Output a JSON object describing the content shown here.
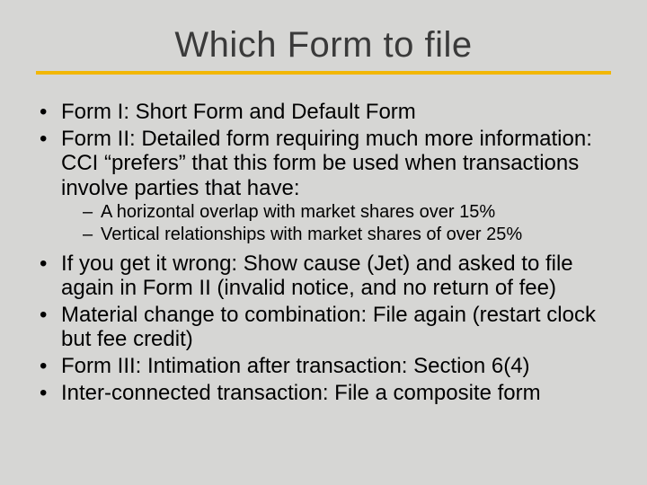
{
  "title": "Which Form to file",
  "bullets": {
    "b1": "Form I: Short Form and Default Form",
    "b2": "Form II: Detailed form requiring much more information: CCI “prefers” that this form be used when transactions involve parties that have:",
    "b2_sub": {
      "s1": "A horizontal overlap with market shares over 15%",
      "s2": "Vertical relationships with market shares of over 25%"
    },
    "b3": "If you get it wrong: Show cause (Jet) and asked to file again in Form II (invalid notice, and no return of fee)",
    "b4": "Material change to combination: File again (restart clock but fee credit)",
    "b5": "Form III: Intimation after transaction: Section 6(4)",
    "b6": "Inter-connected transaction: File a composite form"
  }
}
